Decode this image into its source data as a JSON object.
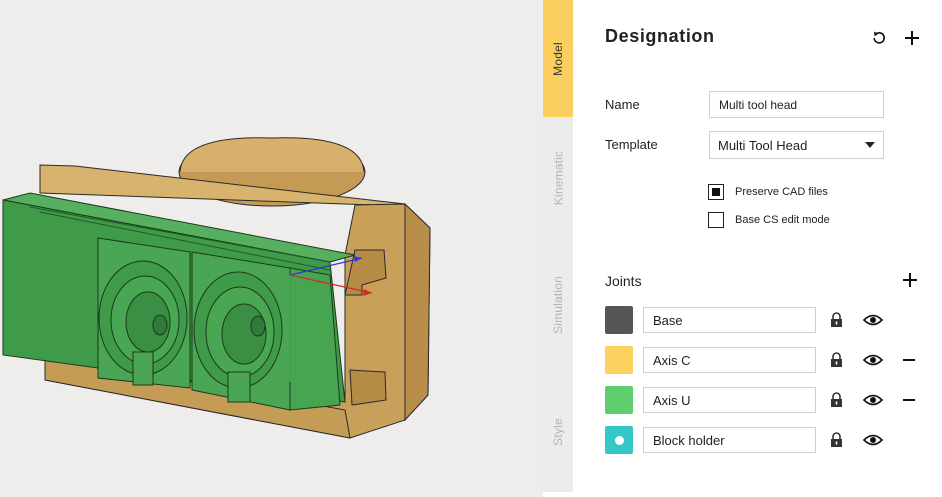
{
  "tabs": [
    {
      "label": "Model",
      "active": true
    },
    {
      "label": "Kinematic",
      "active": false
    },
    {
      "label": "Simulation",
      "active": false
    },
    {
      "label": "Style",
      "active": false
    }
  ],
  "header": {
    "title": "Designation",
    "reset_icon": "reset-icon",
    "add_icon": "plus-icon"
  },
  "form": {
    "name_label": "Name",
    "name_value": "Multi tool head",
    "template_label": "Template",
    "template_value": "Multi Tool Head",
    "preserve_label": "Preserve CAD files",
    "preserve_checked": true,
    "basecs_label": "Base CS edit mode",
    "basecs_checked": false
  },
  "joints": {
    "title": "Joints",
    "items": [
      {
        "label": "Base",
        "color": "#565656",
        "removable": false,
        "dot": false
      },
      {
        "label": "Axis C",
        "color": "#fbd25f",
        "removable": true,
        "dot": false
      },
      {
        "label": "Axis U",
        "color": "#5fcf6d",
        "removable": true,
        "dot": false
      },
      {
        "label": "Block holder",
        "color": "#35c7c7",
        "removable": false,
        "dot": true
      }
    ]
  },
  "colors": {
    "accent": "#fbcf5f",
    "viewport_bg": "#efedeb",
    "model_tan": "#c9a15c",
    "model_green": "#3f9b4a"
  }
}
